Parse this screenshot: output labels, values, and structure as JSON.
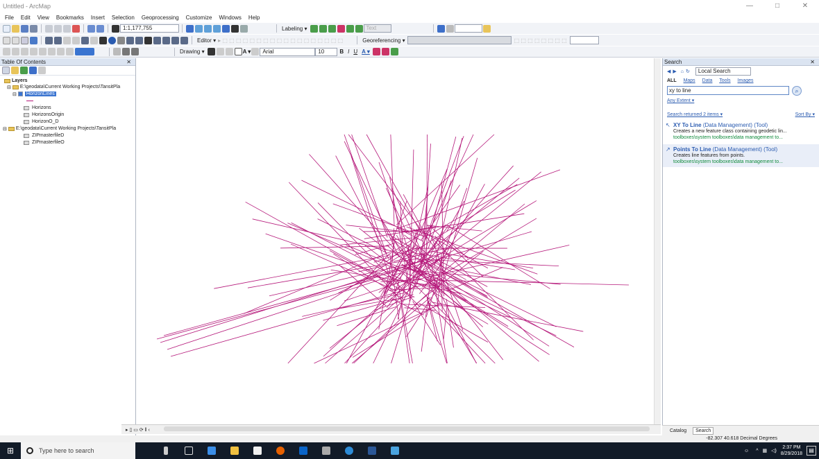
{
  "window": {
    "title": "Untitled - ArcMap",
    "min": "—",
    "max": "□",
    "close": "✕"
  },
  "menu": [
    "File",
    "Edit",
    "View",
    "Bookmarks",
    "Insert",
    "Selection",
    "Geoprocessing",
    "Customize",
    "Windows",
    "Help"
  ],
  "toolbar": {
    "scale": "1:1,177,755",
    "labeling": "Labeling ▾",
    "editor": "Editor ▾",
    "georeferencing": "Georeferencing ▾",
    "drawing": "Drawing ▾",
    "font": "Arial",
    "font_size": "10",
    "bold": "B",
    "italic": "I",
    "underline": "U"
  },
  "toc": {
    "title": "Table Of Contents",
    "close": "✕",
    "layers_root": "Layers",
    "rows": [
      {
        "label": "E:\\geodata\\Current Working Projects\\TansitPla"
      },
      {
        "label": "HorizonLines"
      },
      {
        "label": "Horizons"
      },
      {
        "label": "HorizonsOrigin"
      },
      {
        "label": "HorizonO_D"
      },
      {
        "label": "E:\\geodata\\Current Working Projects\\TansitPla"
      },
      {
        "label": "ZIPmasterfileD"
      },
      {
        "label": "ZIPmasterfileO"
      }
    ]
  },
  "search": {
    "title": "Search",
    "close": "✕",
    "scope": "Local Search",
    "tabs": [
      "ALL",
      "Maps",
      "Data",
      "Tools",
      "Images"
    ],
    "query": "xy to line",
    "extent": "Any Extent ▾",
    "returned": "Search returned 2 items ▾",
    "sort": "Sort By ▾",
    "results": [
      {
        "title": "XY To Line",
        "category": "(Data Management) (Tool)",
        "desc": "Creates a new feature class containing geodetic lin...",
        "path": "toolboxes\\system toolboxes\\data management to..."
      },
      {
        "title": "Points To Line",
        "category": "(Data Management) (Tool)",
        "desc": "Creates line features from points.",
        "path": "toolboxes\\system toolboxes\\data management to..."
      }
    ]
  },
  "bottom_tabs": {
    "catalog": "Catalog",
    "search": "Search"
  },
  "status": {
    "coords": "-82.307  40.618 Decimal Degrees"
  },
  "taskbar": {
    "search_placeholder": "Type here to search",
    "time": "2:37 PM",
    "date": "8/29/2018"
  },
  "colors": {
    "line": "#b5187a",
    "selection": "#3a74d0"
  }
}
